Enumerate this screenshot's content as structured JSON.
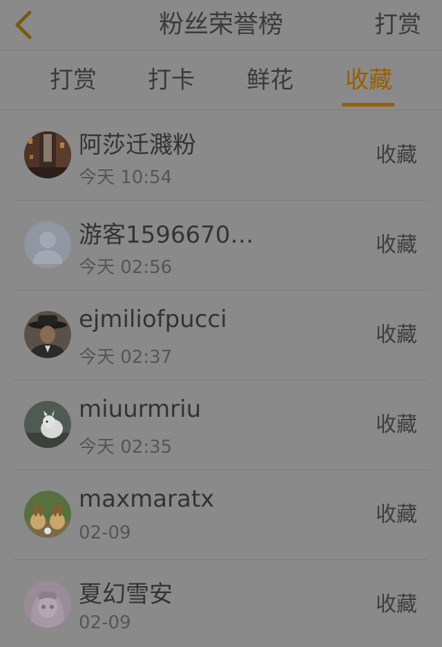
{
  "header": {
    "title": "粉丝荣誉榜",
    "action_label": "打赏"
  },
  "tabs": [
    {
      "label": "打赏"
    },
    {
      "label": "打卡"
    },
    {
      "label": "鲜花"
    },
    {
      "label": "收藏"
    }
  ],
  "active_tab": "收藏",
  "colors": {
    "accent": "#9a5d00",
    "overlay_background": "#8a8a8a",
    "text": "#333333"
  },
  "fans": [
    {
      "name": "阿莎迁濺粉",
      "time": "今天 10:54",
      "action": "收藏",
      "avatar": "street-photo-avatar"
    },
    {
      "name": "游客1596670…",
      "time": "今天 02:56",
      "action": "收藏",
      "avatar": "default-user-avatar"
    },
    {
      "name": "ejmiliofpucci",
      "time": "今天 02:37",
      "action": "收藏",
      "avatar": "man-in-hat-avatar"
    },
    {
      "name": "miuurmriu",
      "time": "今天 02:35",
      "action": "收藏",
      "avatar": "white-cat-avatar"
    },
    {
      "name": "maxmaratx",
      "time": "02-09",
      "action": "收藏",
      "avatar": "rabbits-avatar"
    },
    {
      "name": "夏幻雪安",
      "time": "02-09",
      "action": "收藏",
      "avatar": "anime-girl-avatar"
    }
  ]
}
